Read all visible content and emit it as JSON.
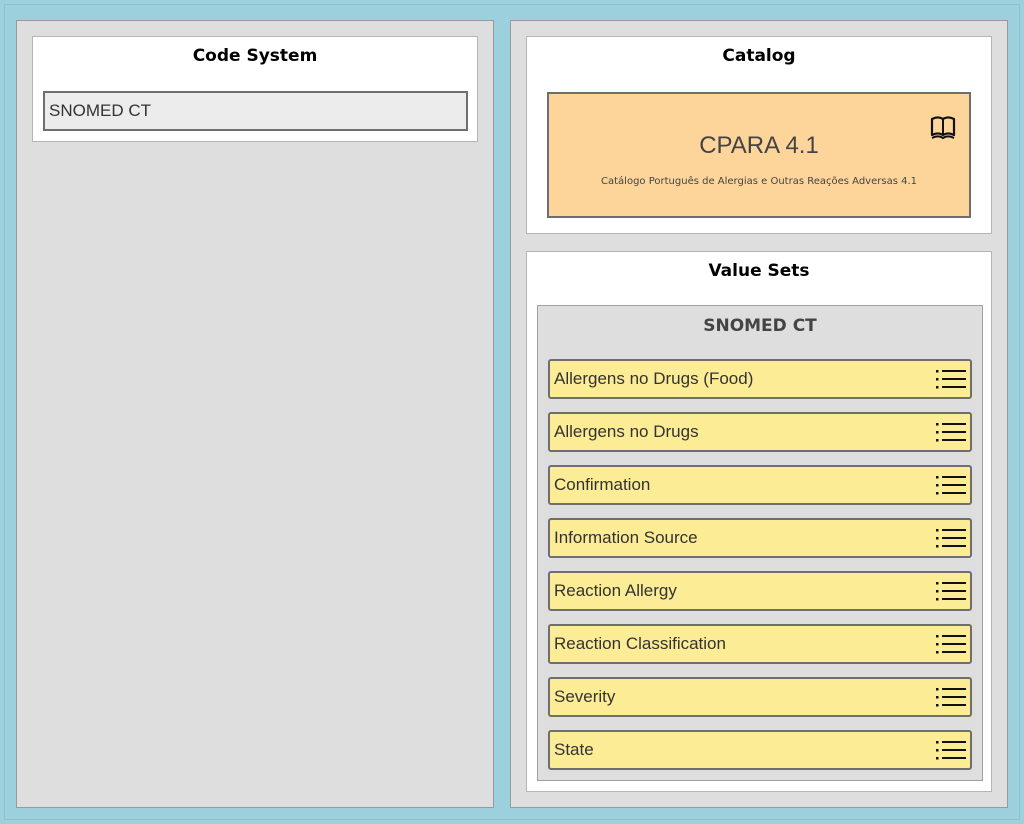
{
  "code_system": {
    "title": "Code System",
    "selected": "SNOMED CT"
  },
  "catalog": {
    "title": "Catalog",
    "name": "CPARA 4.1",
    "description": "Catálogo Português de Alergias e Outras Reações Adversas 4.1",
    "icon": "book-icon",
    "tile_color": "#fdd59b"
  },
  "value_sets": {
    "title": "Value Sets",
    "group": "SNOMED CT",
    "item_icon": "list-icon",
    "item_color": "#fcec95",
    "items": [
      "Allergens no Drugs (Food)",
      "Allergens no Drugs",
      "Confirmation",
      "Information Source",
      "Reaction Allergy",
      "Reaction Classification",
      "Severity",
      "State"
    ]
  }
}
